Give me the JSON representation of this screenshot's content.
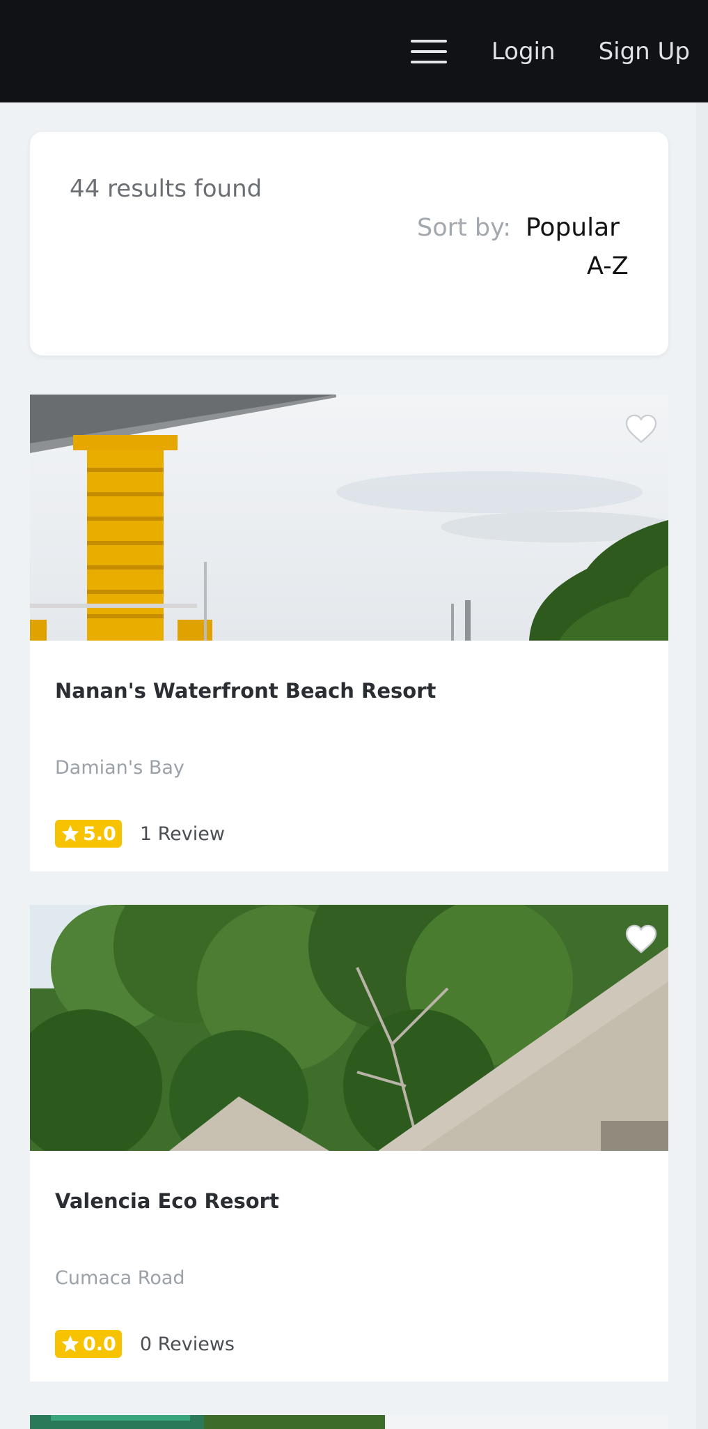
{
  "nav": {
    "login_label": "Login",
    "signup_label": "Sign Up",
    "menu_icon": "hamburger-menu-icon"
  },
  "results": {
    "count_text": "44 results found",
    "sort_label": "Sort by:",
    "sort_options": [
      "Popular",
      "A-Z"
    ]
  },
  "listings": [
    {
      "title": "Nanan's Waterfront Beach Resort",
      "location": "Damian's Bay",
      "rating": "5.0",
      "reviews": "1 Review",
      "favorite_icon": "heart-icon"
    },
    {
      "title": "Valencia Eco Resort",
      "location": "Cumaca Road",
      "rating": "0.0",
      "reviews": "0 Reviews",
      "favorite_icon": "heart-icon"
    }
  ],
  "colors": {
    "topbar_bg": "#101216",
    "page_bg": "#eef2f5",
    "rating_badge": "#f7c200"
  }
}
